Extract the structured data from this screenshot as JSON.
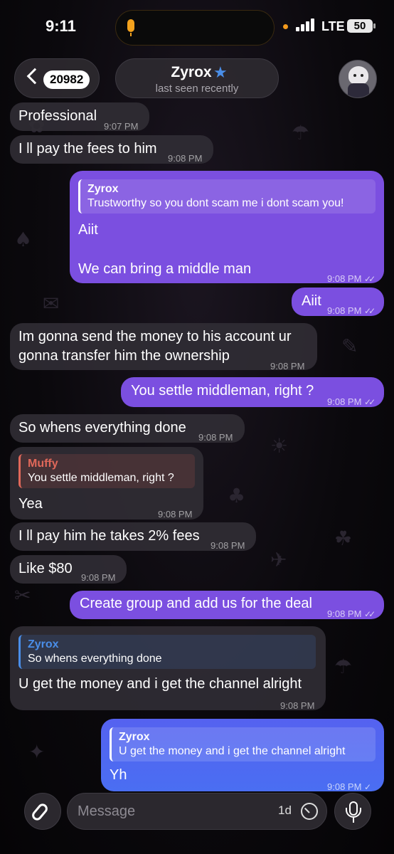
{
  "status_bar": {
    "time": "9:11",
    "network": "LTE",
    "battery": "50"
  },
  "header": {
    "back_badge": "20982",
    "contact_name": "Zyrox",
    "verified_icon": "star-icon",
    "status": "last seen recently"
  },
  "messages": [
    {
      "dir": "in",
      "text": "Professional",
      "time": "9:07 PM"
    },
    {
      "dir": "in",
      "text": "I ll pay the fees to him",
      "time": "9:08 PM"
    },
    {
      "dir": "out",
      "reply_name": "Zyrox",
      "reply_text": "Trustworthy so you dont scam me i dont scam you!",
      "line1": "Aiit",
      "line2": "We can bring a middle man",
      "time": "9:08 PM"
    },
    {
      "dir": "out",
      "text": "Aiit",
      "time": "9:08 PM"
    },
    {
      "dir": "in",
      "line1": "Im gonna send the money to his account ur",
      "line2": "gonna transfer him the ownership",
      "time": "9:08 PM"
    },
    {
      "dir": "out",
      "text": "You settle middleman, right ?",
      "time": "9:08 PM"
    },
    {
      "dir": "in",
      "text": "So whens everything done",
      "time": "9:08 PM"
    },
    {
      "dir": "in",
      "reply_name": "Muffy",
      "reply_text": "You settle middleman, right ?",
      "text": "Yea",
      "time": "9:08 PM"
    },
    {
      "dir": "in",
      "text": "I ll pay him he takes 2% fees",
      "time": "9:08 PM"
    },
    {
      "dir": "in",
      "text": "Like $80",
      "time": "9:08 PM"
    },
    {
      "dir": "out",
      "text": "Create group and add us for the deal",
      "time": "9:08 PM"
    },
    {
      "dir": "in",
      "reply_name": "Zyrox",
      "reply_text": "So whens everything done",
      "text": "U get the money and i get the channel alright",
      "time": "9:08 PM"
    },
    {
      "dir": "out",
      "reply_name": "Zyrox",
      "reply_text": "U get the money and i get the channel alright",
      "text": "Yh",
      "time": "9:08 PM"
    }
  ],
  "read_marks": {
    "double": "✓✓",
    "single": "✓"
  },
  "composer": {
    "placeholder": "Message",
    "timer_label": "1d"
  },
  "colors": {
    "outgoing_bubble": "#7b4fe0",
    "incoming_bubble": "#302c34",
    "reply_zyrox_in": "#4a8ee8",
    "reply_muffy": "#e0685a",
    "verified": "#4a8ee8"
  }
}
